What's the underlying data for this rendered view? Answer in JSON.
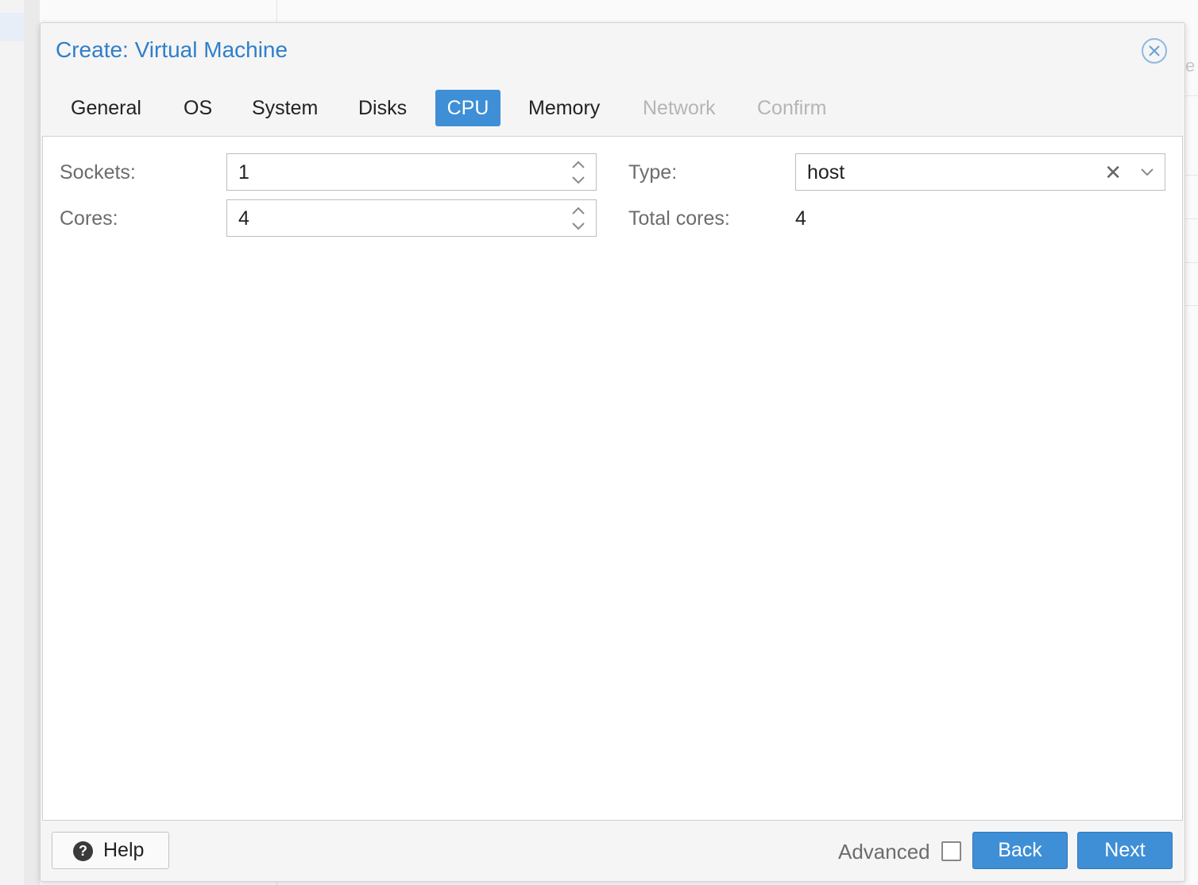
{
  "background": {
    "right_edge_text": "e"
  },
  "dialog": {
    "title": "Create: Virtual Machine",
    "close_icon": "close-circle-icon"
  },
  "tabs": [
    {
      "label": "General",
      "state": "normal"
    },
    {
      "label": "OS",
      "state": "normal"
    },
    {
      "label": "System",
      "state": "normal"
    },
    {
      "label": "Disks",
      "state": "normal"
    },
    {
      "label": "CPU",
      "state": "active"
    },
    {
      "label": "Memory",
      "state": "normal"
    },
    {
      "label": "Network",
      "state": "disabled"
    },
    {
      "label": "Confirm",
      "state": "disabled"
    }
  ],
  "form": {
    "sockets_label": "Sockets:",
    "sockets_value": "1",
    "cores_label": "Cores:",
    "cores_value": "4",
    "type_label": "Type:",
    "type_value": "host",
    "type_clear_glyph": "✕",
    "total_cores_label": "Total cores:",
    "total_cores_value": "4"
  },
  "footer": {
    "help_label": "Help",
    "help_icon_glyph": "?",
    "advanced_label": "Advanced",
    "advanced_checked": false,
    "back_label": "Back",
    "next_label": "Next"
  },
  "colors": {
    "accent": "#3e8fd6",
    "title": "#2f7fc9",
    "disabled_tab": "#b5b5b5"
  }
}
